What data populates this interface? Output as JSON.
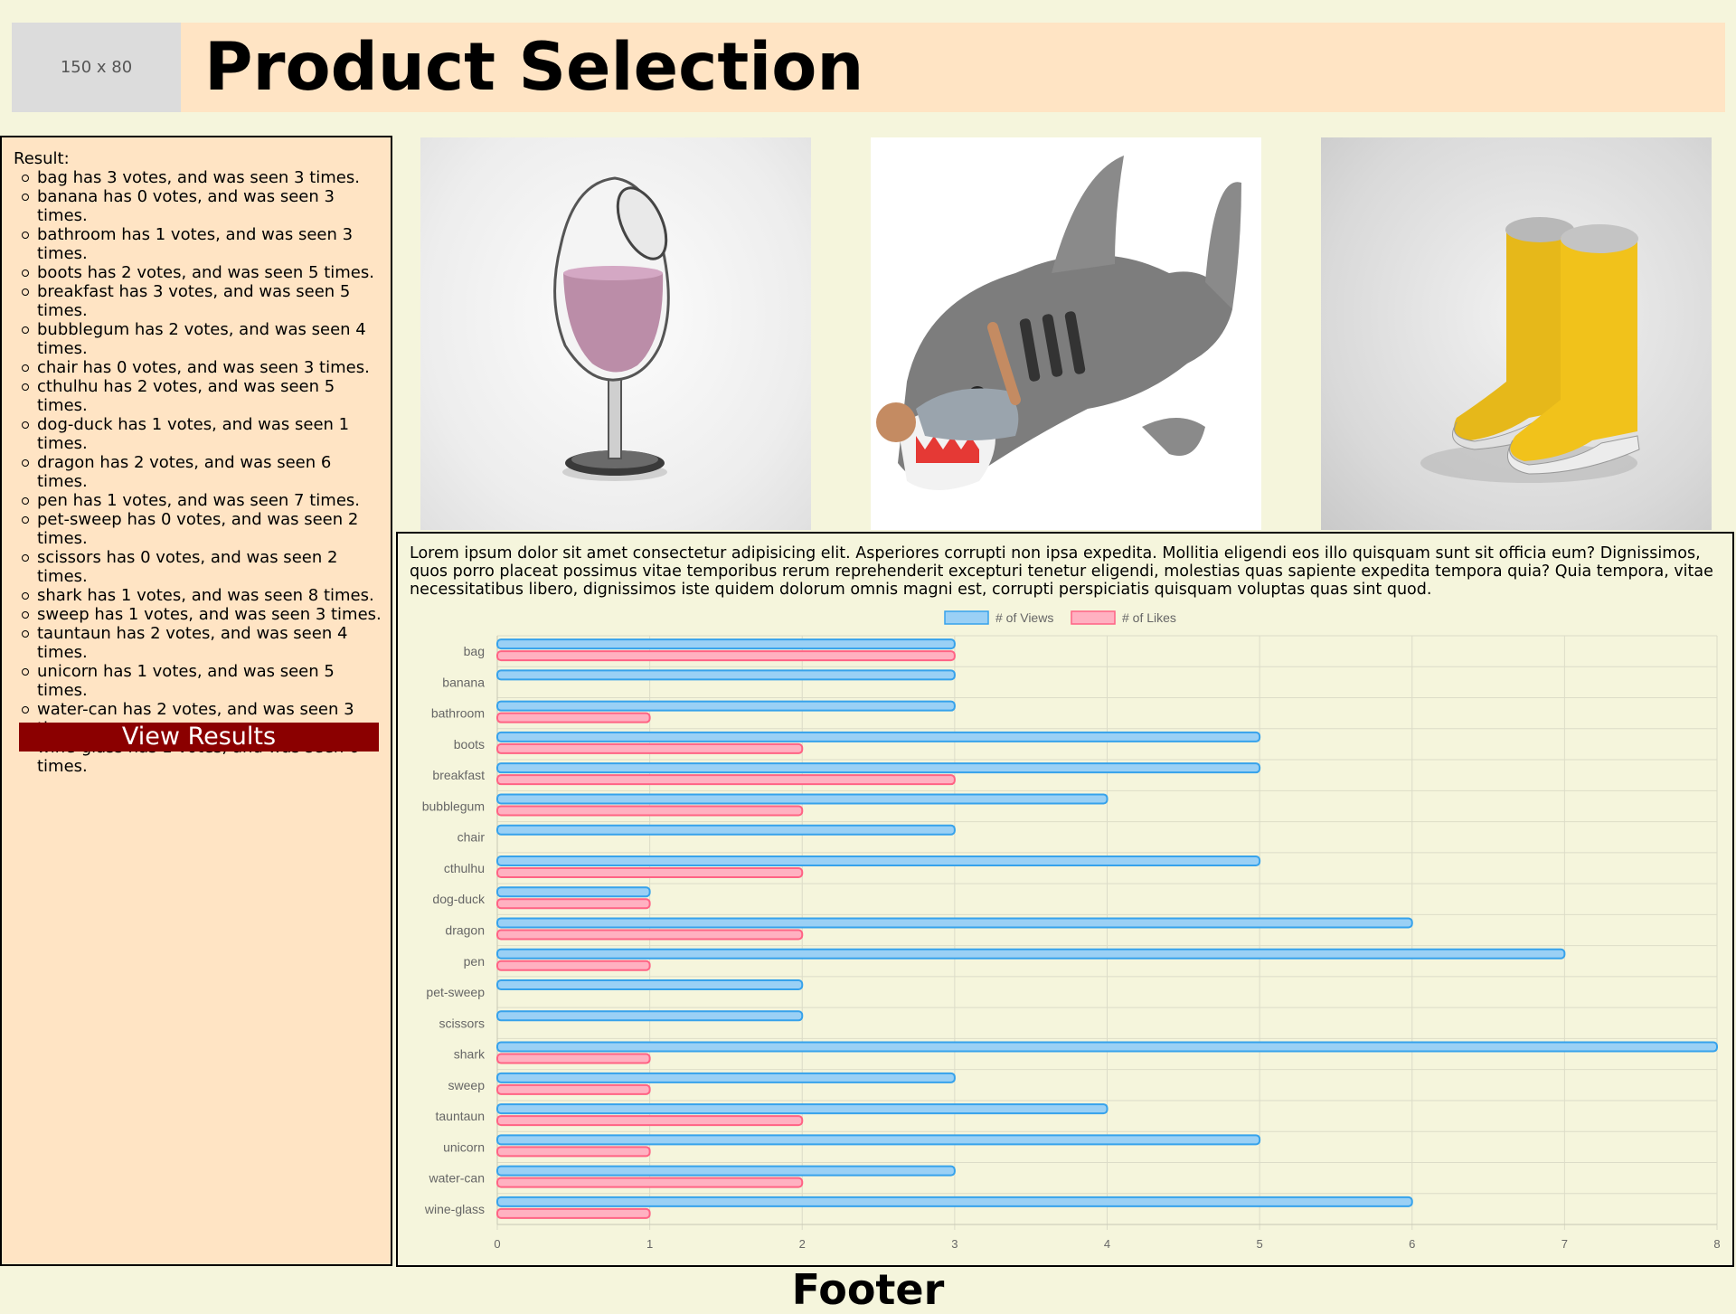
{
  "header": {
    "logo_placeholder": "150 x 80",
    "title": "Product Selection"
  },
  "sidebar": {
    "result_heading": "Result:",
    "results": [
      "bag has 3 votes, and was seen 3 times.",
      "banana has 0 votes, and was seen 3 times.",
      "bathroom has 1 votes, and was seen 3 times.",
      "boots has 2 votes, and was seen 5 times.",
      "breakfast has 3 votes, and was seen 5 times.",
      "bubblegum has 2 votes, and was seen 4 times.",
      "chair has 0 votes, and was seen 3 times.",
      "cthulhu has 2 votes, and was seen 5 times.",
      "dog-duck has 1 votes, and was seen 1 times.",
      "dragon has 2 votes, and was seen 6 times.",
      "pen has 1 votes, and was seen 7 times.",
      "pet-sweep has 0 votes, and was seen 2 times.",
      "scissors has 0 votes, and was seen 2 times.",
      "shark has 1 votes, and was seen 8 times.",
      "sweep has 1 votes, and was seen 3 times.",
      "tauntaun has 2 votes, and was seen 4 times.",
      "unicorn has 1 votes, and was seen 5 times.",
      "water-can has 2 votes, and was seen 3 times.",
      "wine-glass has 1 votes, and was seen 6 times."
    ],
    "view_results_label": "View Results"
  },
  "products": [
    {
      "name": "wine-glass"
    },
    {
      "name": "shark"
    },
    {
      "name": "boots"
    }
  ],
  "main": {
    "lorem": "Lorem ipsum dolor sit amet consectetur adipisicing elit. Asperiores corrupti non ipsa expedita. Mollitia eligendi eos illo quisquam sunt sit officia eum? Dignissimos, quos porro placeat possimus vitae temporibus rerum reprehenderit excepturi tenetur eligendi, molestias quas sapiente expedita tempora quia? Quia tempora, vitae necessitatibus libero, dignissimos iste quidem dolorum omnis magni est, corrupti perspiciatis quisquam voluptas quas sint quod."
  },
  "footer": {
    "text": "Footer"
  },
  "chart_data": {
    "type": "bar",
    "orientation": "horizontal",
    "categories": [
      "bag",
      "banana",
      "bathroom",
      "boots",
      "breakfast",
      "bubblegum",
      "chair",
      "cthulhu",
      "dog-duck",
      "dragon",
      "pen",
      "pet-sweep",
      "scissors",
      "shark",
      "sweep",
      "tauntaun",
      "unicorn",
      "water-can",
      "wine-glass"
    ],
    "series": [
      {
        "name": "# of Views",
        "values": [
          3,
          3,
          3,
          5,
          5,
          4,
          3,
          5,
          1,
          6,
          7,
          2,
          2,
          8,
          3,
          4,
          5,
          3,
          6
        ],
        "fill": "#9ad0f5",
        "stroke": "#36a2eb"
      },
      {
        "name": "# of Likes",
        "values": [
          3,
          0,
          1,
          2,
          3,
          2,
          0,
          2,
          1,
          2,
          1,
          0,
          0,
          1,
          1,
          2,
          1,
          2,
          1
        ],
        "fill": "#ffb1c1",
        "stroke": "#ff6384"
      }
    ],
    "xlim": [
      0,
      8
    ],
    "xticks": [
      "0",
      "1",
      "2",
      "3",
      "4",
      "5",
      "6",
      "7",
      "8"
    ],
    "legend_position": "top",
    "grid": true
  }
}
